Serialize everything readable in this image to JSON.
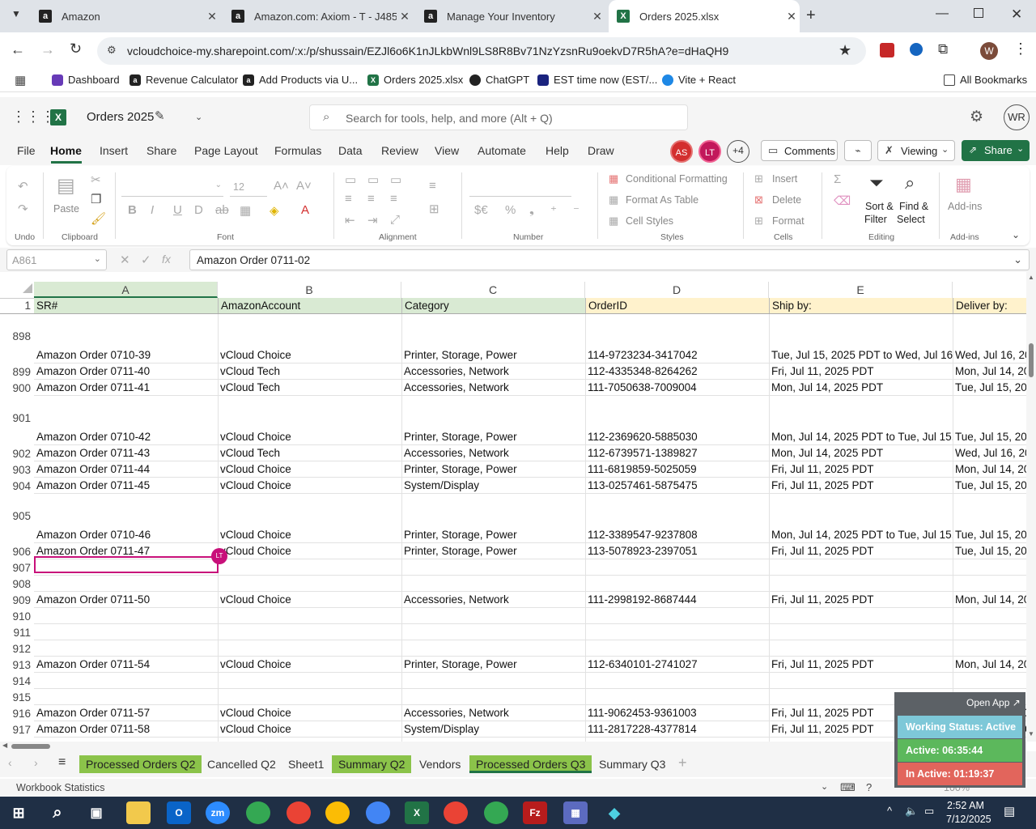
{
  "browser": {
    "tabs": [
      {
        "title": "Amazon",
        "icon": "amazon-icon",
        "active": false
      },
      {
        "title": "Amazon.com: Axiom - T - J485",
        "icon": "amazon-icon",
        "active": false
      },
      {
        "title": "Manage Your Inventory",
        "icon": "amazon-icon",
        "active": false
      },
      {
        "title": "Orders 2025.xlsx",
        "icon": "excel-icon",
        "active": true
      }
    ],
    "url": "vcloudchoice-my.sharepoint.com/:x:/p/shussain/EZJl6o6K1nJLkbWnl9LS8R8Bv71NzYzsnRu9oekvD7R5hA?e=dHaQH9",
    "bookmarks": [
      "Dashboard",
      "Revenue Calculator",
      "Add Products via U...",
      "Orders 2025.xlsx",
      "ChatGPT",
      "EST time now (EST/...",
      "Vite + React"
    ],
    "all_bookmarks": "All Bookmarks",
    "profile_initial": "W"
  },
  "excel": {
    "file_title": "Orders 2025",
    "search_placeholder": "Search for tools, help, and more (Alt + Q)",
    "user_initials": "WR",
    "menus": [
      "File",
      "Home",
      "Insert",
      "Share",
      "Page Layout",
      "Formulas",
      "Data",
      "Review",
      "View",
      "Automate",
      "Help",
      "Draw"
    ],
    "active_menu": "Home",
    "collaborators": [
      "AS",
      "LT"
    ],
    "more_collaborators": "+4",
    "comments_label": "Comments",
    "viewing_label": "Viewing",
    "share_label": "Share",
    "ribbon": {
      "undo_group": "Undo",
      "clipboard_group": "Clipboard",
      "paste_label": "Paste",
      "font_group": "Font",
      "font_size": "12",
      "alignment_group": "Alignment",
      "number_group": "Number",
      "styles_group": "Styles",
      "conditional_formatting": "Conditional Formatting",
      "format_as_table": "Format As Table",
      "cell_styles": "Cell Styles",
      "cells_group": "Cells",
      "insert": "Insert",
      "delete": "Delete",
      "format": "Format",
      "editing_group": "Editing",
      "sort_filter_1": "Sort &",
      "sort_filter_2": "Filter",
      "find_select_1": "Find &",
      "find_select_2": "Select",
      "addins_label": "Add-ins",
      "addins_group": "Add-ins"
    },
    "name_box": "A861",
    "formula": "Amazon Order 0711-02",
    "columns": [
      "A",
      "B",
      "C",
      "D",
      "E"
    ],
    "header_row": {
      "num": "1",
      "cells": [
        "SR#",
        "AmazonAccount",
        "Category",
        "OrderID",
        "Ship by:",
        "Deliver by:"
      ]
    },
    "rows": [
      {
        "num": "898",
        "cells": [
          "Amazon Order 0710-39",
          "vCloud Choice",
          "Printer, Storage, Power",
          "114-9723234-3417042",
          "Tue, Jul 15, 2025 PDT to Wed, Jul 16, 2",
          "Wed, Jul 16, 20"
        ]
      },
      {
        "num": "899",
        "cells": [
          "Amazon Order 0711-40",
          "vCloud Tech",
          "Accessories, Network",
          "112-4335348-8264262",
          "Fri, Jul 11, 2025 PDT",
          "Mon, Jul 14, 20"
        ]
      },
      {
        "num": "900",
        "cells": [
          "Amazon Order 0711-41",
          "vCloud Tech",
          "Accessories, Network",
          "111-7050638-7009004",
          "Mon, Jul 14, 2025 PDT",
          "Tue, Jul 15, 202"
        ]
      },
      {
        "num": "901",
        "cells": [
          "Amazon Order 0710-42",
          "vCloud Choice",
          "Printer, Storage, Power",
          "112-2369620-5885030",
          "Mon, Jul 14, 2025 PDT to Tue, Jul 15, 2",
          "Tue, Jul 15, 202"
        ]
      },
      {
        "num": "902",
        "cells": [
          "Amazon Order 0711-43",
          "vCloud Tech",
          "Accessories, Network",
          "112-6739571-1389827",
          "Mon, Jul 14, 2025 PDT",
          "Wed, Jul 16, 20"
        ]
      },
      {
        "num": "903",
        "cells": [
          "Amazon Order 0711-44",
          "vCloud Choice",
          "Printer, Storage, Power",
          "111-6819859-5025059",
          "Fri, Jul 11, 2025 PDT",
          "Mon, Jul 14, 20"
        ]
      },
      {
        "num": "904",
        "cells": [
          "Amazon Order 0711-45",
          "vCloud Choice",
          "System/Display",
          "113-0257461-5875475",
          "Fri, Jul 11, 2025 PDT",
          "Tue, Jul 15, 202"
        ]
      },
      {
        "num": "905",
        "cells": [
          "Amazon Order 0710-46",
          "vCloud Choice",
          "Printer, Storage, Power",
          "112-3389547-9237808",
          "Mon, Jul 14, 2025 PDT to Tue, Jul 15, 2",
          "Tue, Jul 15, 202"
        ]
      },
      {
        "num": "906",
        "cells": [
          "Amazon Order 0711-47",
          "vCloud Choice",
          "Printer, Storage, Power",
          "113-5078923-2397051",
          "Fri, Jul 11, 2025 PDT",
          "Tue, Jul 15, 202"
        ]
      },
      {
        "num": "907",
        "cells": [
          "",
          "",
          "",
          "",
          "",
          ""
        ]
      },
      {
        "num": "908",
        "cells": [
          "",
          "",
          "",
          "",
          "",
          ""
        ]
      },
      {
        "num": "909",
        "cells": [
          "Amazon Order 0711-50",
          "vCloud Choice",
          "Accessories, Network",
          "111-2998192-8687444",
          "Fri, Jul 11, 2025 PDT",
          "Mon, Jul 14, 20"
        ]
      },
      {
        "num": "910",
        "cells": [
          "",
          "",
          "",
          "",
          "",
          ""
        ]
      },
      {
        "num": "911",
        "cells": [
          "",
          "",
          "",
          "",
          "",
          ""
        ]
      },
      {
        "num": "912",
        "cells": [
          "",
          "",
          "",
          "",
          "",
          ""
        ]
      },
      {
        "num": "913",
        "cells": [
          "Amazon Order 0711-54",
          "vCloud Choice",
          "Printer, Storage, Power",
          "112-6340101-2741027",
          "Fri, Jul 11, 2025 PDT",
          "Mon, Jul 14, 20"
        ]
      },
      {
        "num": "914",
        "cells": [
          "",
          "",
          "",
          "",
          "",
          ""
        ]
      },
      {
        "num": "915",
        "cells": [
          "",
          "",
          "",
          "",
          "",
          ""
        ]
      },
      {
        "num": "916",
        "cells": [
          "Amazon Order 0711-57",
          "vCloud Choice",
          "Accessories, Network",
          "111-9062453-9361003",
          "Fri, Jul 11, 2025 PDT",
          "Mon, Jul 14, 20"
        ]
      },
      {
        "num": "917",
        "cells": [
          "Amazon Order 0711-58",
          "vCloud Choice",
          "System/Display",
          "111-2817228-4377814",
          "Fri, Jul 11, 2025 PDT",
          "Tue, Jul 15, 20"
        ]
      }
    ],
    "presence_badge": "LT",
    "sheet_tabs": [
      {
        "name": "Processed Orders Q2",
        "green": true,
        "active": false
      },
      {
        "name": "Cancelled Q2",
        "green": false,
        "active": false
      },
      {
        "name": "Sheet1",
        "green": false,
        "active": false
      },
      {
        "name": "Summary Q2",
        "green": true,
        "active": false
      },
      {
        "name": "Vendors",
        "green": false,
        "active": false
      },
      {
        "name": "Processed Orders Q3",
        "green": true,
        "active": true
      },
      {
        "name": "Summary Q3",
        "green": false,
        "active": false
      }
    ],
    "status_left": "Workbook Statistics",
    "zoom": "100%"
  },
  "widget": {
    "open_app": "Open App ↗",
    "working_status": "Working Status: Active",
    "active": "Active: 06:35:44",
    "inactive": "In Active: 01:19:37"
  },
  "taskbar": {
    "time": "2:52 AM",
    "date": "7/12/2025"
  },
  "colors": {
    "excel_green": "#217346",
    "sheet_green": "#8bc34a",
    "header_a": "#d9ead3",
    "header_d": "#fff2cc",
    "selection": "#c8107a"
  }
}
